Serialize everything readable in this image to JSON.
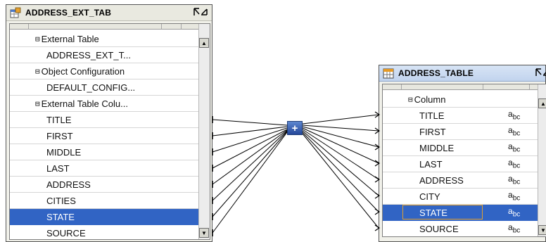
{
  "external_table_operator": {
    "title": "ADDRESS_EXT_TAB",
    "icon": "external-table-icon",
    "rows": [
      {
        "kind": "group",
        "toggle": "⊟",
        "label": "External Table"
      },
      {
        "kind": "item",
        "label": "ADDRESS_EXT_T..."
      },
      {
        "kind": "group",
        "toggle": "⊟",
        "label": "Object Configuration"
      },
      {
        "kind": "item",
        "label": "DEFAULT_CONFIG..."
      },
      {
        "kind": "group",
        "toggle": "⊟",
        "label": "External Table Colu..."
      },
      {
        "kind": "item",
        "label": "TITLE"
      },
      {
        "kind": "item",
        "label": "FIRST"
      },
      {
        "kind": "item",
        "label": "MIDDLE"
      },
      {
        "kind": "item",
        "label": "LAST"
      },
      {
        "kind": "item",
        "label": "ADDRESS"
      },
      {
        "kind": "item",
        "label": "CITIES"
      },
      {
        "kind": "item",
        "label": "STATE",
        "selected": true
      },
      {
        "kind": "item",
        "label": "SOURCE"
      }
    ]
  },
  "table_operator": {
    "title": "ADDRESS_TABLE",
    "icon": "table-icon",
    "type_label": "a b c",
    "rows": [
      {
        "kind": "group",
        "toggle": "⊟",
        "label": "Column"
      },
      {
        "kind": "item",
        "label": "TITLE",
        "type": "abc"
      },
      {
        "kind": "item",
        "label": "FIRST",
        "type": "abc"
      },
      {
        "kind": "item",
        "label": "MIDDLE",
        "type": "abc"
      },
      {
        "kind": "item",
        "label": "LAST",
        "type": "abc"
      },
      {
        "kind": "item",
        "label": "ADDRESS",
        "type": "abc"
      },
      {
        "kind": "item",
        "label": "CITY",
        "type": "abc"
      },
      {
        "kind": "item",
        "label": "STATE",
        "type": "abc",
        "selected": true
      },
      {
        "kind": "item",
        "label": "SOURCE",
        "type": "abc"
      }
    ]
  },
  "join_operator": {
    "label": "+",
    "icon": "join-operator-icon"
  },
  "colors": {
    "selection": "#3164c4",
    "header_active": "#c2d4ee",
    "wire": "#000000"
  }
}
